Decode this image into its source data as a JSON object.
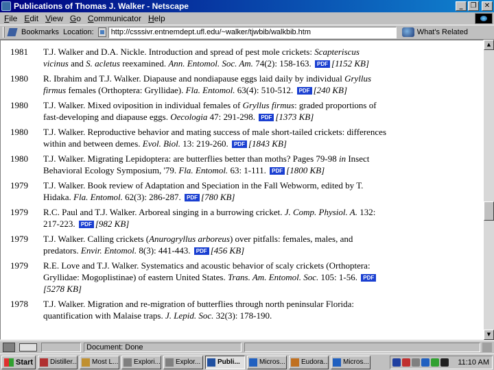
{
  "window": {
    "title": "Publications of Thomas J. Walker - Netscape",
    "controls": {
      "minimize": "_",
      "maximize": "❐",
      "close": "✕"
    }
  },
  "menu": [
    {
      "pre": "",
      "u": "F",
      "post": "ile"
    },
    {
      "pre": "",
      "u": "E",
      "post": "dit"
    },
    {
      "pre": "",
      "u": "V",
      "post": "iew"
    },
    {
      "pre": "",
      "u": "G",
      "post": "o"
    },
    {
      "pre": "",
      "u": "C",
      "post": "ommunicator"
    },
    {
      "pre": "",
      "u": "H",
      "post": "elp"
    }
  ],
  "location_bar": {
    "bookmarks_label": "Bookmarks",
    "location_label": "Location:",
    "url": "http://csssivr.entnemdept.ufl.edu/~walker/tjwbib/walkbib.htm",
    "related_label": "What's Related"
  },
  "publications": [
    {
      "year": "1981",
      "html": "T.J. Walker and D.A. Nickle. Introduction and spread of pest mole crickets: <i>Scapteriscus vicinus</i> and <i>S. acletus</i> reexamined. <i>Ann. Entomol. Soc. Am.</i> 74(2): 158-163.",
      "pdf": "PDF",
      "size": "[1152 KB]"
    },
    {
      "year": "1980",
      "html": "R. Ibrahim and T.J. Walker. Diapause and nondiapause eggs laid daily by individual <i>Gryllus firmus</i> females (Orthoptera: Gryllidae). <i>Fla. Entomol.</i> 63(4): 510-512.",
      "pdf": "PDF",
      "size": "[240 KB]"
    },
    {
      "year": "1980",
      "html": "T.J. Walker. Mixed oviposition in individual females of <i>Gryllus firmus</i>: graded proportions of fast-developing and diapause eggs. <i>Oecologia</i> 47: 291-298.",
      "pdf": "PDF",
      "size": "[1373 KB]"
    },
    {
      "year": "1980",
      "html": "T.J. Walker. Reproductive behavior and mating success of male short-tailed crickets: differences within and between demes. <i>Evol. Biol.</i> 13: 219-260.",
      "pdf": "PDF",
      "size": "[1843 KB]"
    },
    {
      "year": "1980",
      "html": "T.J. Walker. Migrating Lepidoptera: are butterflies better than moths? Pages 79-98 <i>in</i> Insect Behavioral Ecology Symposium, '79. <i>Fla. Entomol.</i> 63: 1-111.",
      "pdf": "PDF",
      "size": "[1800 KB]"
    },
    {
      "year": "1979",
      "html": "T.J. Walker. Book review of Adaptation and Speciation in the Fall Webworm, edited by T. Hidaka. <i>Fla. Entomol.</i> 62(3): 286-287.",
      "pdf": "PDF",
      "size": "[780 KB]"
    },
    {
      "year": "1979",
      "html": "R.C. Paul and T.J. Walker. Arboreal singing in a burrowing cricket. <i>J. Comp. Physiol. A.</i> 132: 217-223.",
      "pdf": "PDF",
      "size": "[982 KB]"
    },
    {
      "year": "1979",
      "html": "T.J. Walker. Calling crickets (<i>Anurogryllus arboreus</i>) over pitfalls: females, males, and predators. <i>Envir. Entomol.</i> 8(3): 441-443.",
      "pdf": "PDF",
      "size": "[456 KB]"
    },
    {
      "year": "1979",
      "html": "R.E. Love and T.J. Walker. Systematics and acoustic behavior of scaly crickets (Orthoptera: Gryllidae: Mogoplistinae) of eastern United States. <i>Trans. Am. Entomol. Soc.</i> 105: 1-56.",
      "pdf": "PDF",
      "size": "[5278 KB]"
    },
    {
      "year": "1978",
      "html": "T.J. Walker. Migration and re-migration of butterflies through north peninsular Florida: quantification with Malaise traps. <i>J. Lepid. Soc.</i> 32(3): 178-190.",
      "pdf": "",
      "size": ""
    }
  ],
  "status": {
    "text": "Document: Done"
  },
  "taskbar": {
    "start": "Start",
    "tasks": [
      {
        "label": "Distiller...",
        "color": "#b03030",
        "active": false
      },
      {
        "label": "Most L...",
        "color": "#c09030",
        "active": false
      },
      {
        "label": "Explori...",
        "color": "#808080",
        "active": false
      },
      {
        "label": "Explor...",
        "color": "#808080",
        "active": false
      },
      {
        "label": "Publi...",
        "color": "#2050a0",
        "active": true
      },
      {
        "label": "Micros...",
        "color": "#2060c0",
        "active": false
      },
      {
        "label": "Eudora...",
        "color": "#c07020",
        "active": false
      },
      {
        "label": "Micros...",
        "color": "#2060c0",
        "active": false
      }
    ],
    "tray_colors": [
      "#2040a0",
      "#c03030",
      "#808080",
      "#2060c0",
      "#30a030",
      "#202020"
    ],
    "clock": "11:10 AM"
  }
}
